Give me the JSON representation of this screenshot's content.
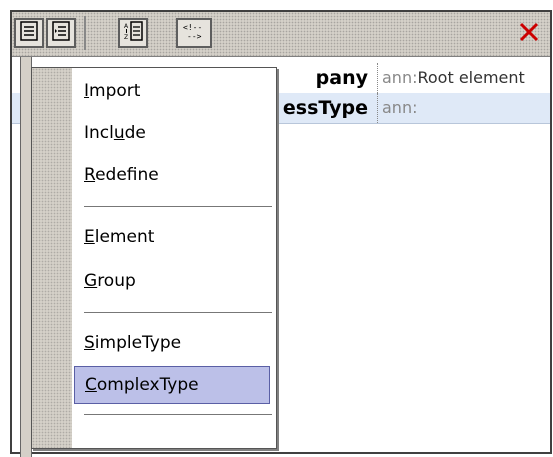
{
  "toolbar": {
    "buttons": [
      "append-icon",
      "insert-icon",
      "sort-icon",
      "comment-icon",
      "close-icon"
    ]
  },
  "grid": {
    "rows": [
      {
        "name": "pany",
        "ann_label": "ann:",
        "ann_value": "Root element"
      },
      {
        "name": "essType",
        "ann_label": "ann:",
        "ann_value": ""
      }
    ]
  },
  "menu": {
    "items": [
      {
        "pre": "",
        "acc": "I",
        "post": "mport"
      },
      {
        "pre": "Incl",
        "acc": "u",
        "post": "de"
      },
      {
        "pre": "",
        "acc": "R",
        "post": "edefine"
      },
      {
        "pre": "",
        "acc": "E",
        "post": "lement"
      },
      {
        "pre": "",
        "acc": "G",
        "post": "roup"
      },
      {
        "pre": "",
        "acc": "S",
        "post": "impleType"
      },
      {
        "pre": "",
        "acc": "C",
        "post": "omplexType"
      }
    ]
  },
  "colors": {
    "highlight": "#bcc0e8",
    "close": "#cc0000"
  }
}
